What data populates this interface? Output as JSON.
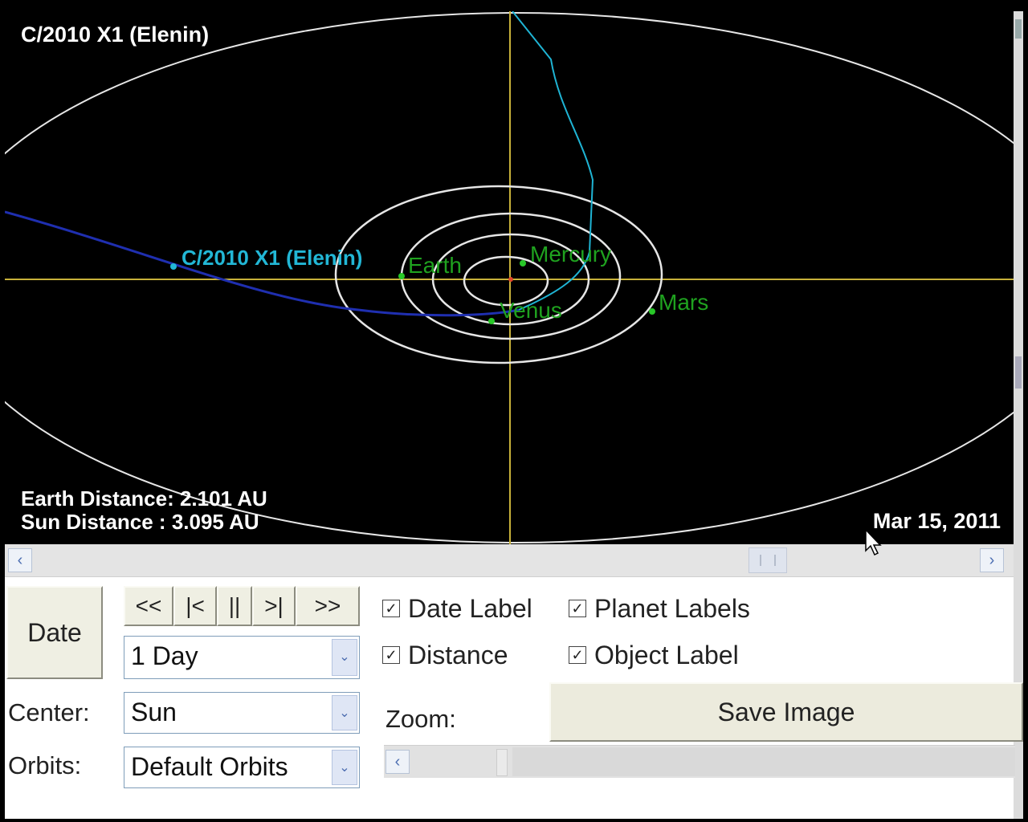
{
  "viewer": {
    "title": "C/2010 X1 (Elenin)",
    "object_label": "C/2010 X1 (Elenin)",
    "planets": [
      "Earth",
      "Mercury",
      "Venus",
      "Mars"
    ],
    "earth_distance": "Earth Distance: 2.101 AU",
    "sun_distance": "Sun Distance   : 3.095 AU",
    "date": "Mar 15, 2011",
    "colors": {
      "background": "#000000",
      "orbits": "#e6e6e6",
      "axes": "#c8b23a",
      "comet_orbit": "#1f2fb0",
      "comet_tail": "#1fb4d4",
      "planet_label": "#1fa21f",
      "object_label": "#22b7d6"
    }
  },
  "timeline": {
    "left_icon": "chevron-left-icon",
    "right_icon": "chevron-right-icon"
  },
  "controls": {
    "date_button": "Date",
    "nav": {
      "rewind": "<<",
      "step_back": "|<",
      "pause": "||",
      "step_forward": ">|",
      "fast_forward": ">>"
    },
    "step_select": "1 Day",
    "center_label": "Center:",
    "center_select": "Sun",
    "orbits_label": "Orbits:",
    "orbits_select": "Default Orbits",
    "checkboxes": {
      "date_label": {
        "label": "Date Label",
        "checked": true
      },
      "planet_labels": {
        "label": "Planet Labels",
        "checked": true
      },
      "distance": {
        "label": "Distance",
        "checked": true
      },
      "object_label": {
        "label": "Object Label",
        "checked": true
      }
    },
    "zoom_label": "Zoom:",
    "save_button": "Save Image",
    "check_glyph": "✓",
    "dropdown_glyph": "⌄"
  }
}
